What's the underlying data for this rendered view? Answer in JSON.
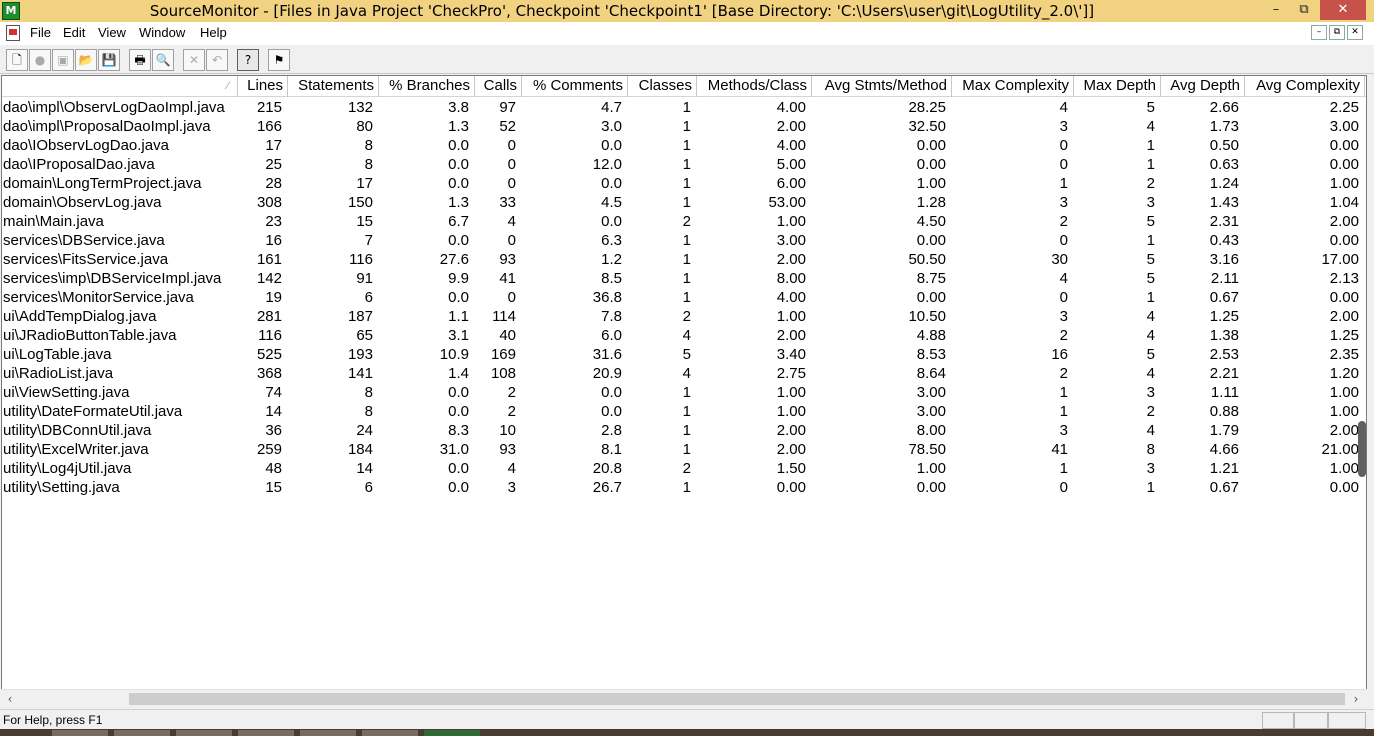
{
  "window": {
    "title": "SourceMonitor - [Files in Java Project 'CheckPro', Checkpoint 'Checkpoint1'  [Base Directory: 'C:\\Users\\user\\git\\LogUtility_2.0\\']]",
    "controls": {
      "minimize": "–",
      "maximize": "⧉",
      "close": "✕"
    }
  },
  "menu": {
    "items": [
      "File",
      "Edit",
      "View",
      "Window",
      "Help"
    ],
    "mdi": {
      "minimize": "–",
      "restore": "⧉",
      "close": "✕"
    }
  },
  "toolbar": {
    "icons": [
      {
        "name": "new-icon",
        "glyph": "🗋"
      },
      {
        "name": "record-icon",
        "glyph": "●"
      },
      {
        "name": "checkpoints-icon",
        "glyph": "▣"
      },
      {
        "name": "open-icon",
        "glyph": "📂"
      },
      {
        "name": "save-icon",
        "glyph": "💾"
      },
      {
        "name": "print-icon",
        "glyph": "🖶"
      },
      {
        "name": "print-preview-icon",
        "glyph": "🔍"
      },
      {
        "name": "delete-icon",
        "glyph": "✕"
      },
      {
        "name": "undo-icon",
        "glyph": "↶"
      },
      {
        "name": "help-icon",
        "glyph": "?"
      },
      {
        "name": "context-help-icon",
        "glyph": "⚑"
      }
    ]
  },
  "table": {
    "sort_indicator": "∕",
    "columns": [
      "Lines",
      "Statements",
      "% Branches",
      "Calls",
      "% Comments",
      "Classes",
      "Methods/Class",
      "Avg Stmts/Method",
      "Max Complexity",
      "Max Depth",
      "Avg Depth",
      "Avg Complexity"
    ],
    "rows": [
      [
        "dao\\impl\\ObservLogDaoImpl.java",
        "215",
        "132",
        "3.8",
        "97",
        "4.7",
        "1",
        "4.00",
        "28.25",
        "4",
        "5",
        "2.66",
        "2.25"
      ],
      [
        "dao\\impl\\ProposalDaoImpl.java",
        "166",
        "80",
        "1.3",
        "52",
        "3.0",
        "1",
        "2.00",
        "32.50",
        "3",
        "4",
        "1.73",
        "3.00"
      ],
      [
        "dao\\IObservLogDao.java",
        "17",
        "8",
        "0.0",
        "0",
        "0.0",
        "1",
        "4.00",
        "0.00",
        "0",
        "1",
        "0.50",
        "0.00"
      ],
      [
        "dao\\IProposalDao.java",
        "25",
        "8",
        "0.0",
        "0",
        "12.0",
        "1",
        "5.00",
        "0.00",
        "0",
        "1",
        "0.63",
        "0.00"
      ],
      [
        "domain\\LongTermProject.java",
        "28",
        "17",
        "0.0",
        "0",
        "0.0",
        "1",
        "6.00",
        "1.00",
        "1",
        "2",
        "1.24",
        "1.00"
      ],
      [
        "domain\\ObservLog.java",
        "308",
        "150",
        "1.3",
        "33",
        "4.5",
        "1",
        "53.00",
        "1.28",
        "3",
        "3",
        "1.43",
        "1.04"
      ],
      [
        "main\\Main.java",
        "23",
        "15",
        "6.7",
        "4",
        "0.0",
        "2",
        "1.00",
        "4.50",
        "2",
        "5",
        "2.31",
        "2.00"
      ],
      [
        "services\\DBService.java",
        "16",
        "7",
        "0.0",
        "0",
        "6.3",
        "1",
        "3.00",
        "0.00",
        "0",
        "1",
        "0.43",
        "0.00"
      ],
      [
        "services\\FitsService.java",
        "161",
        "116",
        "27.6",
        "93",
        "1.2",
        "1",
        "2.00",
        "50.50",
        "30",
        "5",
        "3.16",
        "17.00"
      ],
      [
        "services\\imp\\DBServiceImpl.java",
        "142",
        "91",
        "9.9",
        "41",
        "8.5",
        "1",
        "8.00",
        "8.75",
        "4",
        "5",
        "2.11",
        "2.13"
      ],
      [
        "services\\MonitorService.java",
        "19",
        "6",
        "0.0",
        "0",
        "36.8",
        "1",
        "4.00",
        "0.00",
        "0",
        "1",
        "0.67",
        "0.00"
      ],
      [
        "ui\\AddTempDialog.java",
        "281",
        "187",
        "1.1",
        "114",
        "7.8",
        "2",
        "1.00",
        "10.50",
        "3",
        "4",
        "1.25",
        "2.00"
      ],
      [
        "ui\\JRadioButtonTable.java",
        "116",
        "65",
        "3.1",
        "40",
        "6.0",
        "4",
        "2.00",
        "4.88",
        "2",
        "4",
        "1.38",
        "1.25"
      ],
      [
        "ui\\LogTable.java",
        "525",
        "193",
        "10.9",
        "169",
        "31.6",
        "5",
        "3.40",
        "8.53",
        "16",
        "5",
        "2.53",
        "2.35"
      ],
      [
        "ui\\RadioList.java",
        "368",
        "141",
        "1.4",
        "108",
        "20.9",
        "4",
        "2.75",
        "8.64",
        "2",
        "4",
        "2.21",
        "1.20"
      ],
      [
        "ui\\ViewSetting.java",
        "74",
        "8",
        "0.0",
        "2",
        "0.0",
        "1",
        "1.00",
        "3.00",
        "1",
        "3",
        "1.11",
        "1.00"
      ],
      [
        "utility\\DateFormateUtil.java",
        "14",
        "8",
        "0.0",
        "2",
        "0.0",
        "1",
        "1.00",
        "3.00",
        "1",
        "2",
        "0.88",
        "1.00"
      ],
      [
        "utility\\DBConnUtil.java",
        "36",
        "24",
        "8.3",
        "10",
        "2.8",
        "1",
        "2.00",
        "8.00",
        "3",
        "4",
        "1.79",
        "2.00"
      ],
      [
        "utility\\ExcelWriter.java",
        "259",
        "184",
        "31.0",
        "93",
        "8.1",
        "1",
        "2.00",
        "78.50",
        "41",
        "8",
        "4.66",
        "21.00"
      ],
      [
        "utility\\Log4jUtil.java",
        "48",
        "14",
        "0.0",
        "4",
        "20.8",
        "2",
        "1.50",
        "1.00",
        "1",
        "3",
        "1.21",
        "1.00"
      ],
      [
        "utility\\Setting.java",
        "15",
        "6",
        "0.0",
        "3",
        "26.7",
        "1",
        "0.00",
        "0.00",
        "0",
        "1",
        "0.67",
        "0.00"
      ]
    ]
  },
  "scrollbar": {
    "left": "‹",
    "right": "›"
  },
  "status": {
    "text": "For Help, press F1"
  }
}
